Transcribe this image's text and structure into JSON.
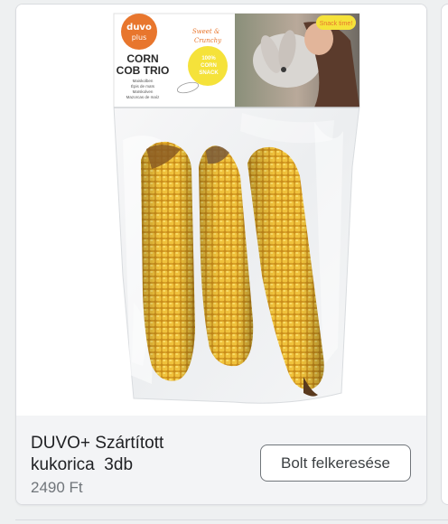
{
  "product": {
    "title_line1": "DUVO+ Szártított",
    "title_line2": "kukorica  3db",
    "price": "2490 Ft"
  },
  "actions": {
    "visit_store_label": "Bolt felkeresése"
  },
  "package_label": {
    "brand_top": "duvo",
    "brand_bottom": "plus",
    "product_line1": "CORN",
    "product_line2": "COB TRIO",
    "tagline_line1": "Sweet &",
    "tagline_line2": "Crunchy",
    "badge": "Snack time!",
    "sticker_line1": "100%",
    "sticker_line2": "CORN",
    "sticker_line3": "SNACK",
    "translations": [
      "Maiskolben",
      "Épis de maïs",
      "Maïskolven",
      "Mazorcas de maíz"
    ]
  },
  "colors": {
    "card_bg": "#ffffff",
    "info_bg": "#f3f4f6",
    "title_text": "#202124",
    "price_text": "#70757a",
    "brand_orange": "#e8762d",
    "sticker_yellow": "#f5e23a",
    "corn_yellow": "#e9b631"
  }
}
